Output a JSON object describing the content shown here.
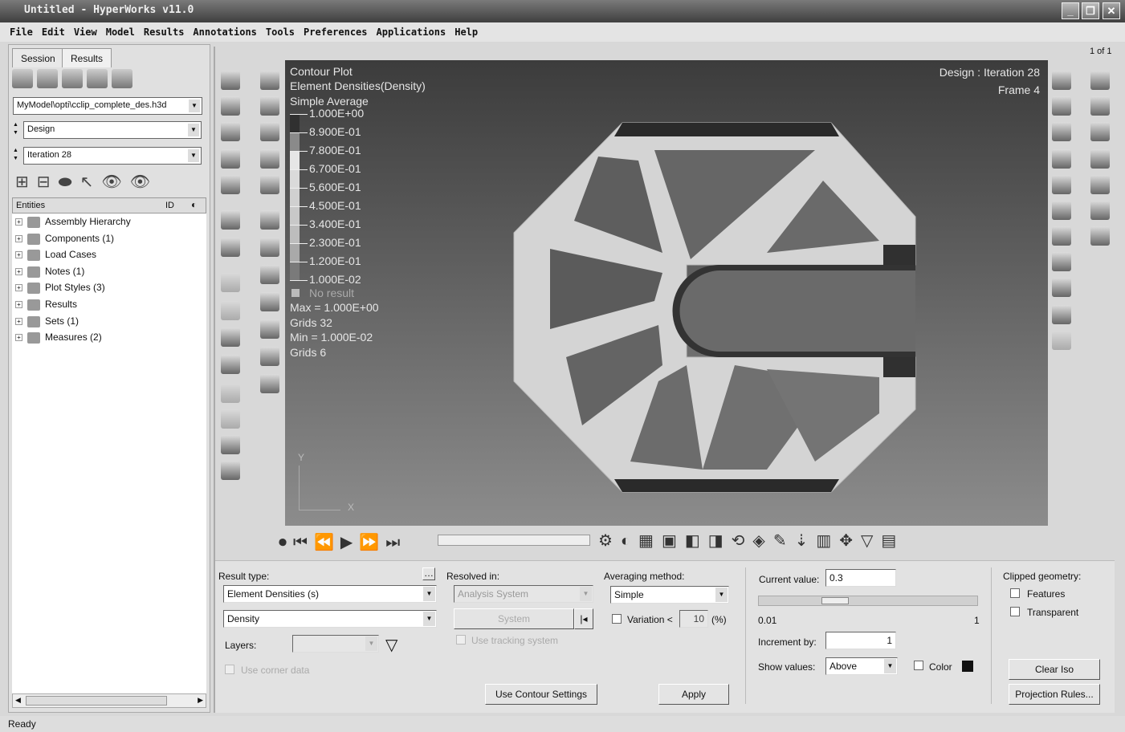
{
  "window": {
    "title": "Untitled - HyperWorks v11.0",
    "min": "_",
    "max": "❐",
    "close": "✕"
  },
  "menu": [
    "File",
    "Edit",
    "View",
    "Model",
    "Results",
    "Annotations",
    "Tools",
    "Preferences",
    "Applications",
    "Help"
  ],
  "left": {
    "tabs": [
      "Session",
      "Results"
    ],
    "file": "MyModel\\opti\\cclip_complete_des.h3d",
    "subcase": "Design",
    "step": "Iteration 28",
    "columns": {
      "entities": "Entities",
      "id": "ID"
    },
    "tree": [
      "Assembly Hierarchy",
      "Components (1)",
      "Load Cases",
      "Notes (1)",
      "Plot Styles (3)",
      "Results",
      "Sets (1)",
      "Measures (2)"
    ]
  },
  "page_counter": "1 of 1",
  "viewport": {
    "title": "Contour Plot",
    "result": "Element Densities(Density)",
    "avg": "Simple Average",
    "design": "Design : Iteration 28",
    "frame": "Frame 4",
    "legend": [
      "1.000E+00",
      "8.900E-01",
      "7.800E-01",
      "6.700E-01",
      "5.600E-01",
      "4.500E-01",
      "3.400E-01",
      "2.300E-01",
      "1.200E-01",
      "1.000E-02"
    ],
    "legend_colors": [
      "#303030",
      "#8a8a8a",
      "#e6e6e6",
      "#dadada",
      "#d0d0d0",
      "#c8c8c8",
      "#bdbdbd",
      "#a9a9a9",
      "#7a7a7a",
      "#0c0c0c"
    ],
    "no_result": "No result",
    "max": "Max = 1.000E+00",
    "max_grid": "Grids 32",
    "min": "Min = 1.000E-02",
    "min_grid": "Grids 6",
    "axis_y": "Y",
    "axis_x": "X"
  },
  "panel": {
    "result_type_label": "Result type:",
    "result_type": "Element Densities (s)",
    "component": "Density",
    "layers_label": "Layers:",
    "corner_data": "Use corner data",
    "resolved_label": "Resolved in:",
    "resolved": "Analysis System",
    "system_btn": "System",
    "tracking": "Use tracking system",
    "avg_label": "Averaging method:",
    "avg": "Simple",
    "variation_label": "Variation <",
    "variation": "10",
    "variation_unit": "(%)",
    "use_contour": "Use Contour Settings",
    "apply": "Apply",
    "current_label": "Current value:",
    "current": "0.3",
    "slider_fraction": 0.3,
    "min": "0.01",
    "max": "1",
    "increment_label": "Increment by:",
    "increment": "1",
    "show_label": "Show values:",
    "show": "Above",
    "color_label": "Color",
    "clipped_label": "Clipped geometry:",
    "features": "Features",
    "transparent": "Transparent",
    "clear_iso": "Clear Iso",
    "projection": "Projection Rules..."
  },
  "status": "Ready"
}
